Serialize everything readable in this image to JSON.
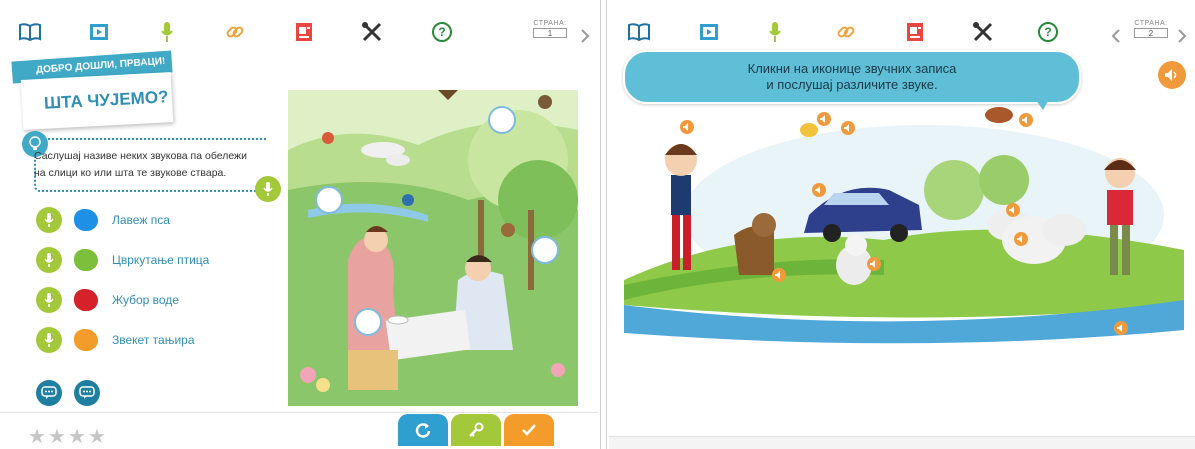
{
  "colors": {
    "accent_blue": "#3fa9c6",
    "text_blue": "#2f8fb4",
    "mic_green": "#a3c93a",
    "speaker_orange": "#f19a3c",
    "reset_blue": "#2f9fd0",
    "key_green": "#a3c93a",
    "check_orange": "#f39c2b"
  },
  "left": {
    "toolbar": {
      "icons": [
        "book-icon",
        "video-icon",
        "microphone-icon",
        "link-icon",
        "document-icon",
        "tools-icon",
        "help-icon"
      ],
      "page_label": "СТРАНА:",
      "page_number": "1"
    },
    "banner": {
      "top": "ДОБРО ДОШЛИ, ПРВАЦИ!",
      "title": "ШТА ЧУЈЕМО?"
    },
    "instruction_line1": "Саслушај називе неких звукова па обележи",
    "instruction_line2": "на слици ко или шта те звукове ствара.",
    "sounds": [
      {
        "label": "Лавеж пса",
        "color": "#1e90e6"
      },
      {
        "label": "Цвркутање птица",
        "color": "#7bbf3a"
      },
      {
        "label": "Жубор воде",
        "color": "#d6202a"
      },
      {
        "label": "Звекет тањира",
        "color": "#f39c2b"
      }
    ],
    "rating": {
      "stars_total": 4,
      "stars_filled": 0
    },
    "actions": [
      "reset-icon",
      "key-icon",
      "check-icon"
    ]
  },
  "right": {
    "toolbar": {
      "page_label": "СТРАНА:",
      "page_number": "2"
    },
    "bubble_line1": "Кликни на иконице звучних записа",
    "bubble_line2": "и послушај различите звуке."
  }
}
